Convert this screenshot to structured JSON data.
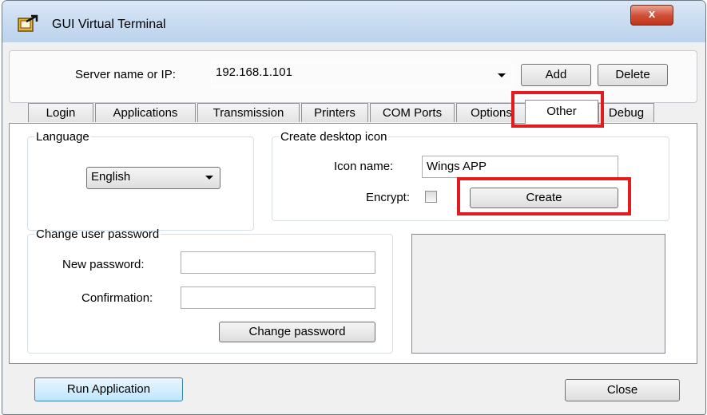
{
  "window": {
    "title": "GUI Virtual Terminal",
    "close_glyph": "x"
  },
  "server": {
    "label": "Server name or IP:",
    "value": "192.168.1.101",
    "add_label": "Add",
    "delete_label": "Delete"
  },
  "tabs": [
    {
      "label": "Login"
    },
    {
      "label": "Applications"
    },
    {
      "label": "Transmission"
    },
    {
      "label": "Printers"
    },
    {
      "label": "COM Ports"
    },
    {
      "label": "Options"
    },
    {
      "label": "Other"
    },
    {
      "label": "Debug"
    }
  ],
  "active_tab": "Other",
  "language": {
    "group_label": "Language",
    "selected": "English"
  },
  "desktop_icon": {
    "group_label": "Create desktop icon",
    "icon_name_label": "Icon name:",
    "icon_name_value": "Wings APP",
    "encrypt_label": "Encrypt:",
    "encrypt_checked": false,
    "create_label": "Create"
  },
  "password": {
    "group_label": "Change user password",
    "new_label": "New password:",
    "confirm_label": "Confirmation:",
    "change_label": "Change password"
  },
  "footer": {
    "run_label": "Run Application",
    "close_label": "Close"
  },
  "colors": {
    "highlight": "#e01c1c",
    "titlebar": "#c9dcf1",
    "close_button": "#d2523b"
  }
}
